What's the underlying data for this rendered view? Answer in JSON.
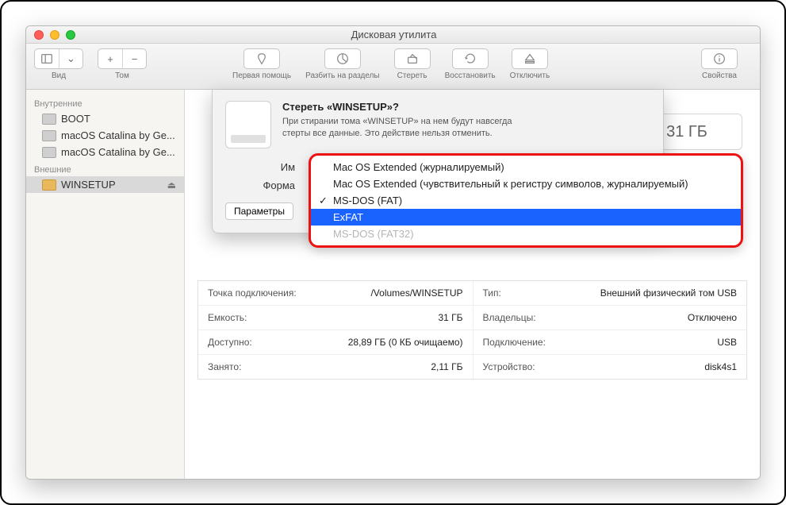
{
  "window": {
    "title": "Дисковая утилита"
  },
  "toolbar": {
    "view": "Вид",
    "volume": "Том",
    "first_aid": "Первая помощь",
    "partition": "Разбить на разделы",
    "erase": "Стереть",
    "restore": "Восстановить",
    "unmount": "Отключить",
    "info": "Свойства"
  },
  "sidebar": {
    "internal_header": "Внутренние",
    "external_header": "Внешние",
    "internal": [
      {
        "label": "BOOT"
      },
      {
        "label": "macOS Catalina by Ge..."
      },
      {
        "label": "macOS Catalina by Ge..."
      }
    ],
    "external": [
      {
        "label": "WINSETUP"
      }
    ]
  },
  "sizebox": "31 ГБ",
  "sheet": {
    "title": "Стереть «WINSETUP»?",
    "desc": "При стирании тома «WINSETUP» на нем будут навсегда стерты все данные. Это действие нельзя отменить.",
    "name_label": "Им",
    "format_label": "Форма",
    "params_btn": "Параметры"
  },
  "dropdown": {
    "options": [
      {
        "label": "Mac OS Extended (журналируемый)"
      },
      {
        "label": "Mac OS Extended (чувствительный к регистру символов, журналируемый)"
      },
      {
        "label": "MS-DOS (FAT)",
        "checked": true
      },
      {
        "label": "ExFAT",
        "selected": true
      },
      {
        "label": "MS-DOS (FAT32)",
        "disabled": true
      }
    ]
  },
  "info": {
    "rows": [
      {
        "l": {
          "k": "Точка подключения:",
          "v": "/Volumes/WINSETUP"
        },
        "r": {
          "k": "Тип:",
          "v": "Внешний физический том USB"
        }
      },
      {
        "l": {
          "k": "Емкость:",
          "v": "31 ГБ"
        },
        "r": {
          "k": "Владельцы:",
          "v": "Отключено"
        }
      },
      {
        "l": {
          "k": "Доступно:",
          "v": "28,89 ГБ (0 КБ очищаемо)"
        },
        "r": {
          "k": "Подключение:",
          "v": "USB"
        }
      },
      {
        "l": {
          "k": "Занято:",
          "v": "2,11 ГБ"
        },
        "r": {
          "k": "Устройство:",
          "v": "disk4s1"
        }
      }
    ]
  }
}
